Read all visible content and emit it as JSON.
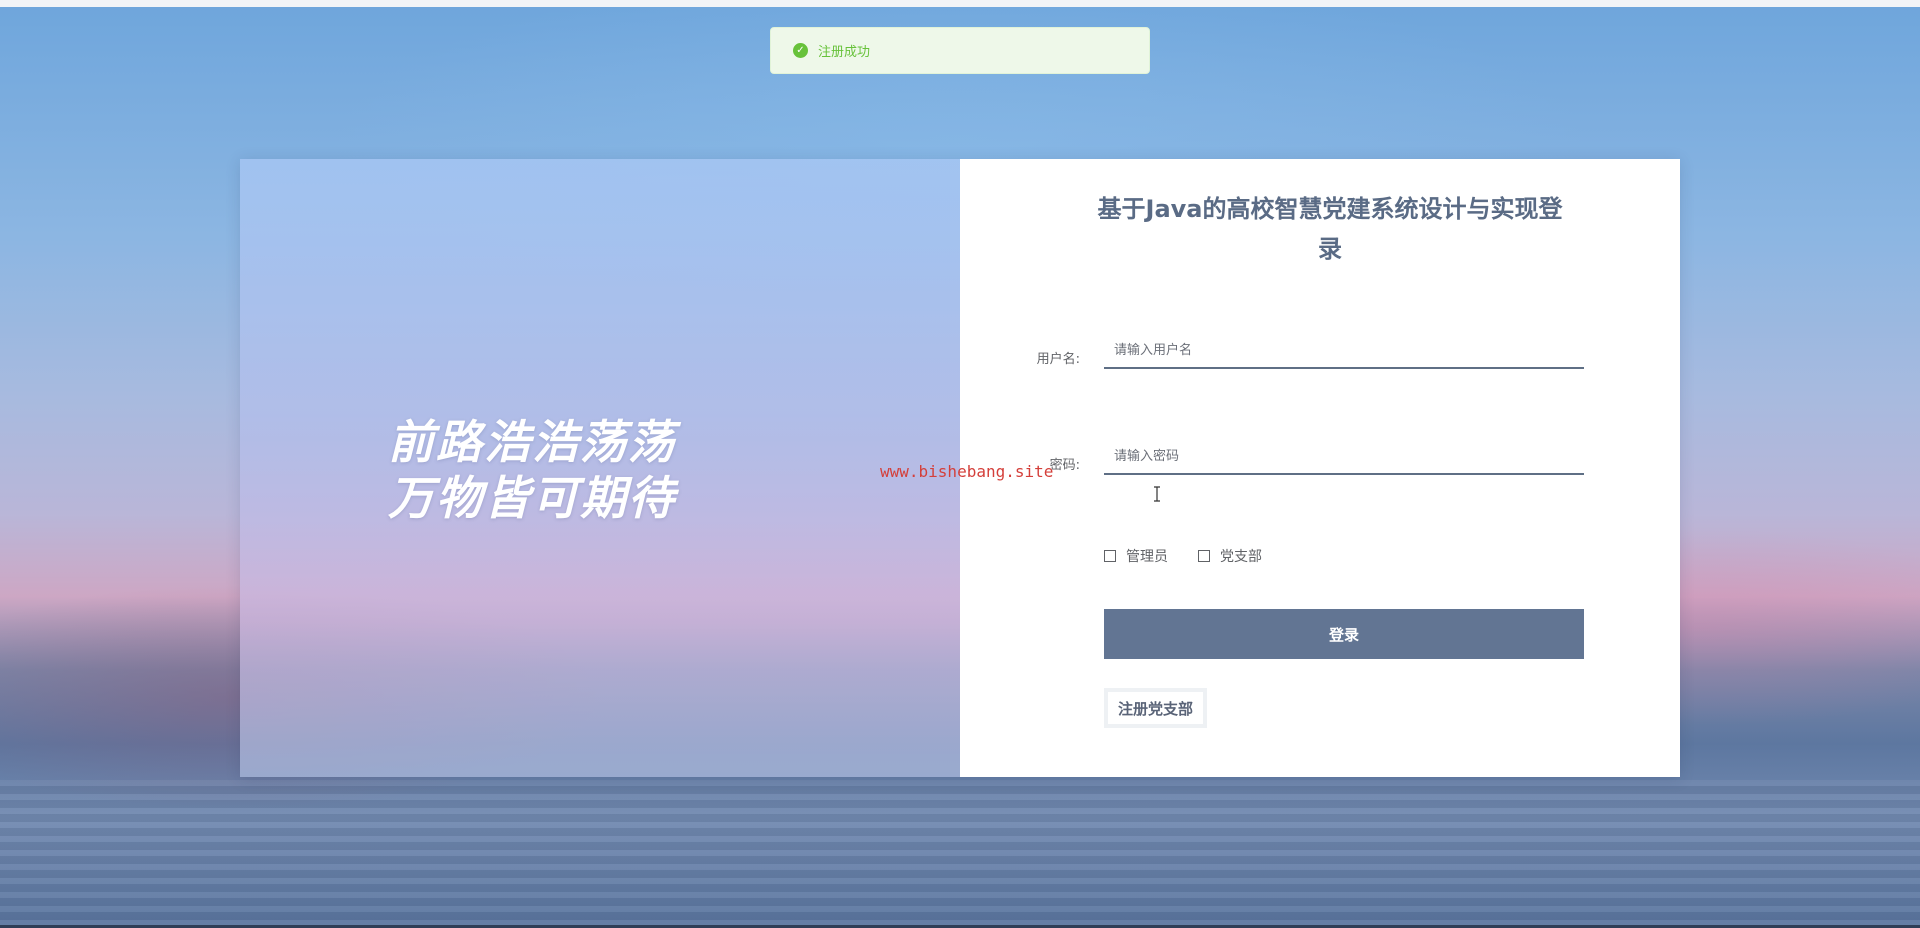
{
  "toast": {
    "icon": "check-circle-icon",
    "message": "注册成功",
    "color": "#67c23a"
  },
  "hero": {
    "slogan_line1": "前路浩浩荡荡",
    "slogan_line2": "万物皆可期待"
  },
  "form": {
    "title": "基于Java的高校智慧党建系统设计与实现登录",
    "username": {
      "label": "用户名:",
      "value": "",
      "placeholder": "请输入用户名"
    },
    "password": {
      "label": "密码:",
      "value": "",
      "placeholder": "请输入密码"
    },
    "roles": [
      {
        "label": "管理员",
        "checked": false
      },
      {
        "label": "党支部",
        "checked": false
      }
    ],
    "login_label": "登录",
    "register_label": "注册党支部"
  },
  "watermark": "www.bishebang.site",
  "colors": {
    "accent": "#627593",
    "title": "#5a6b85",
    "success": "#67c23a"
  }
}
